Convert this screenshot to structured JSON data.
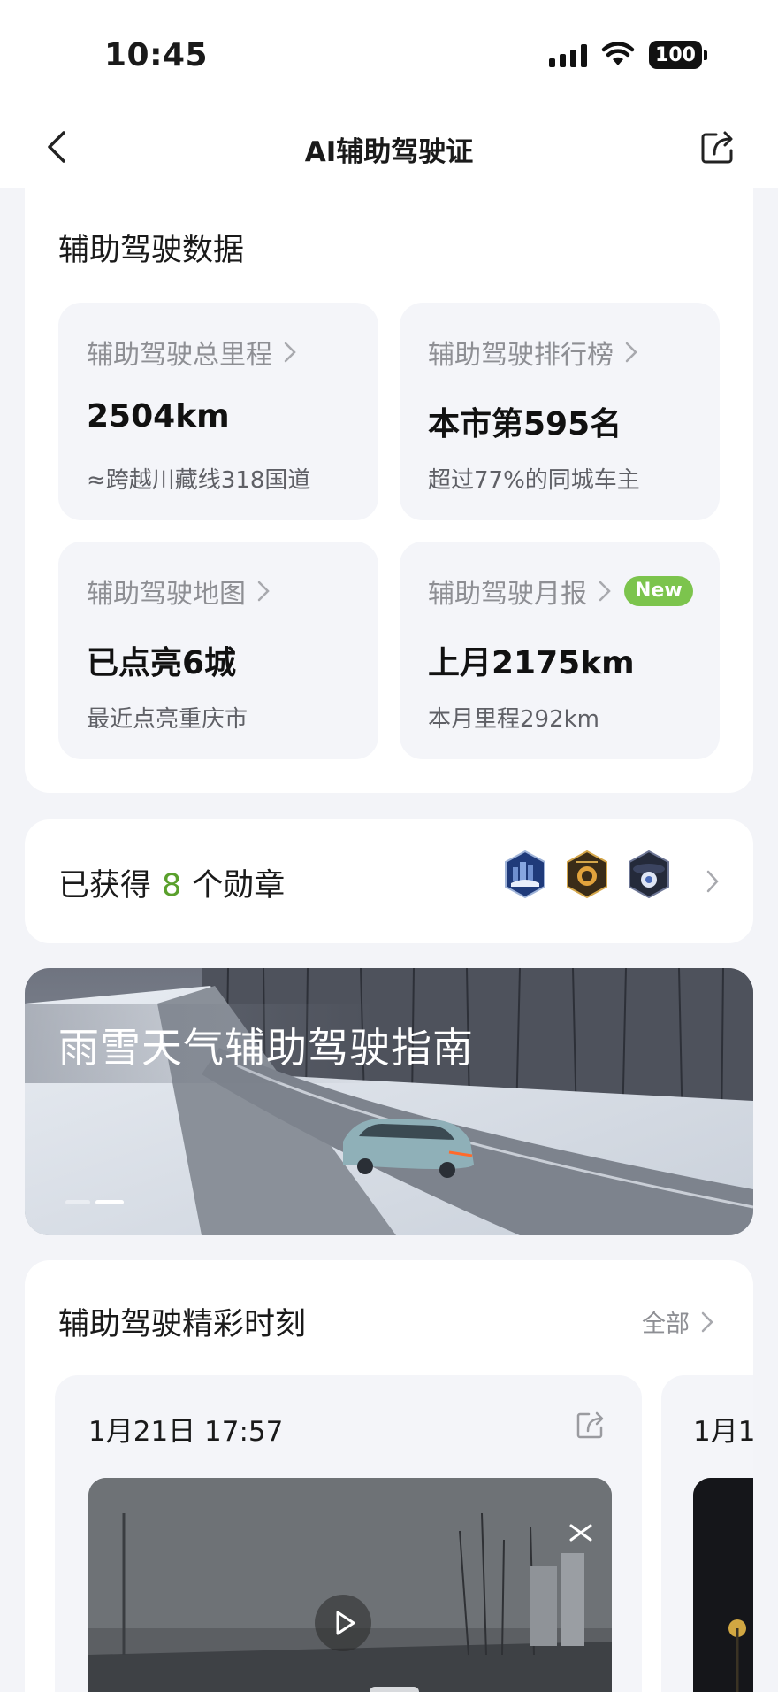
{
  "status_bar": {
    "time": "10:45",
    "battery": "100"
  },
  "nav": {
    "title": "AI辅助驾驶证",
    "back_icon": "chevron-left-icon",
    "share_icon": "share-icon"
  },
  "driving_data": {
    "title": "辅助驾驶数据",
    "tiles": [
      {
        "label": "辅助驾驶总里程",
        "value": "2504km",
        "sub": "≈跨越川藏线318国道"
      },
      {
        "label": "辅助驾驶排行榜",
        "value": "本市第595名",
        "sub": "超过77%的同城车主"
      },
      {
        "label": "辅助驾驶地图",
        "value": "已点亮6城",
        "sub": "最近点亮重庆市"
      },
      {
        "label": "辅助驾驶月报",
        "value": "上月2175km",
        "sub": "本月里程292km",
        "badge": "New"
      }
    ]
  },
  "medals": {
    "prefix": "已获得",
    "count": "8",
    "suffix": "个勋章"
  },
  "banner": {
    "title": "雨雪天气辅助驾驶指南"
  },
  "moments": {
    "title": "辅助驾驶精彩时刻",
    "more_label": "全部",
    "cards": [
      {
        "date": "1月21日 17:57"
      },
      {
        "date": "1月1"
      }
    ]
  },
  "colors": {
    "accent_green": "#5aa02c",
    "badge_green": "#7cc44d",
    "page_bg": "#f3f4f8",
    "tile_bg": "#f4f5f9"
  }
}
